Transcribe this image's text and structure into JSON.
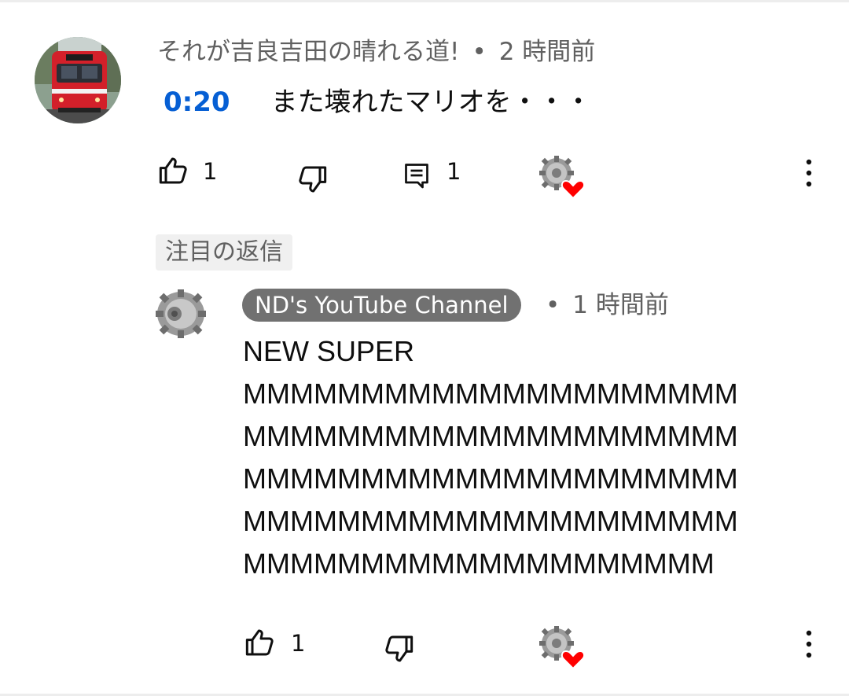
{
  "comment": {
    "author": "それが吉良吉田の晴れる道!",
    "separator": "•",
    "time": "2 時間前",
    "timestamp_link": "0:20",
    "text": "また壊れたマリオを・・・",
    "like_count": "1",
    "reply_count": "1",
    "avatar_icon": "train-photo-avatar",
    "creator_heart_icon": "creator-heart-icon"
  },
  "pinned_label": "注目の返信",
  "reply": {
    "author": "ND's YouTube Channel",
    "separator": "•",
    "time": "1 時間前",
    "text": "NEW SUPER\nMMMMMMMMMMMMMMMMMMMMM\nMMMMMMMMMMMMMMMMMMMMM\nMMMMMMMMMMMMMMMMMMMMM\nMMMMMMMMMMMMMMMMMMMMM\nMMMMMMMMMMMMMMMMMMMM",
    "like_count": "1",
    "avatar_icon": "gear-avatar",
    "creator_heart_icon": "creator-heart-icon"
  },
  "colors": {
    "link_blue": "#065fd4",
    "channel_chip": "#717171",
    "heart_red": "#ff0000",
    "meta_gray": "#606060"
  }
}
